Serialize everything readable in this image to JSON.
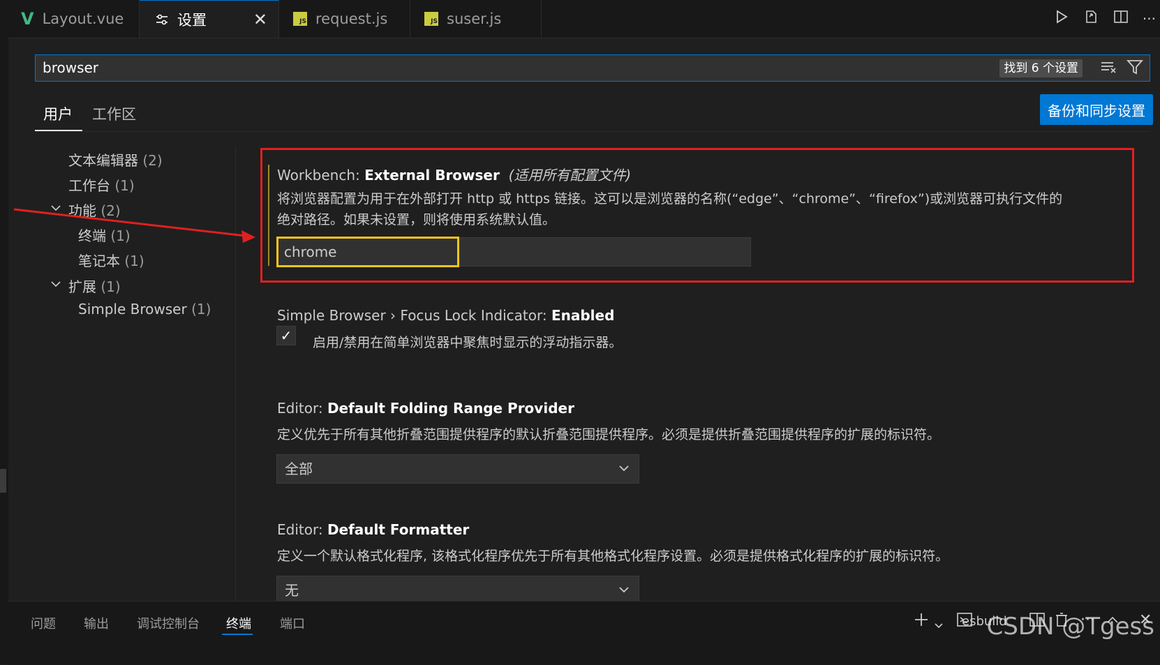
{
  "tabs": [
    {
      "label": "Layout.vue",
      "icon": "vue-icon"
    },
    {
      "label": "设置",
      "icon": "settings-icon",
      "active": true
    },
    {
      "label": "request.js",
      "icon": "js-icon"
    },
    {
      "label": "suser.js",
      "icon": "js-icon"
    }
  ],
  "search": {
    "value": "browser",
    "result_count": "找到 6 个设置"
  },
  "scope_tabs": {
    "user": "用户",
    "workspace": "工作区"
  },
  "sync_button": "备份和同步设置",
  "toc": [
    {
      "label": "文本编辑器",
      "count": "(2)"
    },
    {
      "label": "工作台",
      "count": "(1)"
    },
    {
      "label": "功能",
      "count": "(2)"
    },
    {
      "label": "终端",
      "count": "(1)"
    },
    {
      "label": "笔记本",
      "count": "(1)"
    },
    {
      "label": "扩展",
      "count": "(1)"
    },
    {
      "label": "Simple Browser",
      "count": "(1)"
    }
  ],
  "settings": [
    {
      "category": "Workbench: ",
      "name": "External Browser",
      "scope_note": "(适用所有配置文件)",
      "desc_line1": "将浏览器配置为用于在外部打开 http 或 https 链接。这可以是浏览器的名称(“edge”、“chrome”、“firefox”)或浏览器可执行文件的",
      "desc_line2": "绝对路径。如果未设置，则将使用系统默认值。",
      "value": "chrome"
    },
    {
      "category": "Simple Browser › Focus Lock Indicator: ",
      "name": "Enabled",
      "checkbox_label": "启用/禁用在简单浏览器中聚焦时显示的浮动指示器。",
      "checked": true
    },
    {
      "category": "Editor: ",
      "name": "Default Folding Range Provider",
      "desc": "定义优先于所有其他折叠范围提供程序的默认折叠范围提供程序。必须是提供折叠范围提供程序的扩展的标识符。",
      "value": "全部"
    },
    {
      "category": "Editor: ",
      "name": "Default Formatter",
      "desc": "定义一个默认格式化程序, 该格式化程序优先于所有其他格式化程序设置。必须是提供格式化程序的扩展的标识符。",
      "value": "无"
    }
  ],
  "panel": {
    "tabs": [
      "问题",
      "输出",
      "调试控制台",
      "终端",
      "端口"
    ],
    "active_tab": "终端",
    "terminal_name": "esbuild"
  },
  "watermark": "CSDN @Tgess",
  "colors": {
    "accent": "#0078d4",
    "highlight_red": "#e02020",
    "highlight_yellow": "#f5c518"
  }
}
